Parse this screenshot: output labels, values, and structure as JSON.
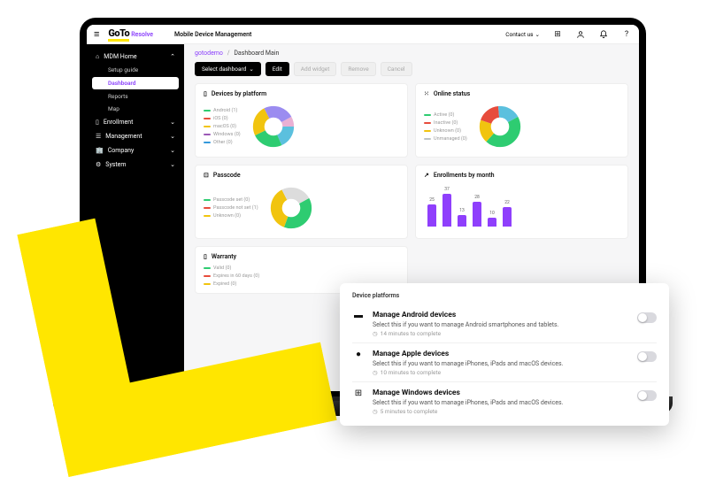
{
  "topbar": {
    "brand_main": "GoTo",
    "brand_sub": "Resolve",
    "page_title": "Mobile Device Management",
    "contact": "Contact us"
  },
  "sidebar": {
    "items": [
      {
        "icon": "home",
        "label": "MDM Home",
        "open": true,
        "children": [
          {
            "label": "Setup guide"
          },
          {
            "label": "Dashboard",
            "active": true
          },
          {
            "label": "Reports"
          },
          {
            "label": "Map"
          }
        ]
      },
      {
        "icon": "phone",
        "label": "Enrollment"
      },
      {
        "icon": "sliders",
        "label": "Management"
      },
      {
        "icon": "building",
        "label": "Company"
      },
      {
        "icon": "gear",
        "label": "System"
      }
    ]
  },
  "breadcrumbs": {
    "root": "gotodemo",
    "current": "Dashboard Main"
  },
  "toolbar": {
    "select_dashboard": "Select dashboard",
    "edit": "Edit",
    "add_widget": "Add widget",
    "remove": "Remove",
    "cancel": "Cancel"
  },
  "cards": {
    "devices_by_platform": {
      "title": "Devices by platform",
      "legend": [
        {
          "label": "Android (1)",
          "color": "#2ecc71"
        },
        {
          "label": "iOS (0)",
          "color": "#e74c3c"
        },
        {
          "label": "macOS (0)",
          "color": "#f1c40f"
        },
        {
          "label": "Windows (0)",
          "color": "#9b59b6"
        },
        {
          "label": "Other (0)",
          "color": "#3498db"
        }
      ]
    },
    "online_status": {
      "title": "Online status",
      "legend": [
        {
          "label": "Active (0)",
          "color": "#2ecc71"
        },
        {
          "label": "Inactive (0)",
          "color": "#e74c3c"
        },
        {
          "label": "Unknown (0)",
          "color": "#f1c40f"
        },
        {
          "label": "Unmanaged (0)",
          "color": "#bdc3c7"
        }
      ]
    },
    "passcode": {
      "title": "Passcode",
      "legend": [
        {
          "label": "Passcode set (0)",
          "color": "#2ecc71"
        },
        {
          "label": "Passcode not set (1)",
          "color": "#e74c3c"
        },
        {
          "label": "Unknown (0)",
          "color": "#f1c40f"
        }
      ]
    },
    "enrollments": {
      "title": "Enrollments by month"
    },
    "warranty": {
      "title": "Warranty",
      "legend": [
        {
          "label": "Valid (0)",
          "color": "#2ecc71"
        },
        {
          "label": "Expires in 60 days (0)",
          "color": "#e74c3c"
        },
        {
          "label": "Expired (0)",
          "color": "#f1c40f"
        }
      ]
    }
  },
  "chart_data": [
    {
      "type": "pie",
      "title": "Devices by platform",
      "series": [
        {
          "name": "Android",
          "value": 1,
          "color": "#2ecc71"
        },
        {
          "name": "iOS",
          "value": 0,
          "color": "#e74c3c"
        },
        {
          "name": "macOS",
          "value": 0,
          "color": "#f1c40f"
        },
        {
          "name": "Windows",
          "value": 0,
          "color": "#9b59b6"
        },
        {
          "name": "Other",
          "value": 0,
          "color": "#3498db"
        }
      ]
    },
    {
      "type": "pie",
      "title": "Online status",
      "series": [
        {
          "name": "Active",
          "value": 0,
          "color": "#2ecc71"
        },
        {
          "name": "Inactive",
          "value": 0,
          "color": "#e74c3c"
        },
        {
          "name": "Unknown",
          "value": 0,
          "color": "#f1c40f"
        },
        {
          "name": "Unmanaged",
          "value": 0,
          "color": "#bdc3c7"
        }
      ]
    },
    {
      "type": "pie",
      "title": "Passcode",
      "series": [
        {
          "name": "Passcode set",
          "value": 0,
          "color": "#2ecc71"
        },
        {
          "name": "Passcode not set",
          "value": 1,
          "color": "#e74c3c"
        },
        {
          "name": "Unknown",
          "value": 0,
          "color": "#f1c40f"
        }
      ]
    },
    {
      "type": "bar",
      "title": "Enrollments by month",
      "categories": [
        "",
        "",
        "",
        "",
        "",
        ""
      ],
      "values": [
        25,
        37,
        13,
        28,
        10,
        22
      ],
      "ylim": [
        0,
        40
      ]
    }
  ],
  "popup": {
    "heading": "Device platforms",
    "rows": [
      {
        "icon": "android",
        "title": "Manage Android devices",
        "desc": "Select this if you want to manage Android smartphones and tablets.",
        "time": "14 minutes to complete"
      },
      {
        "icon": "apple",
        "title": "Manage Apple devices",
        "desc": "Select this if you want to manage iPhones, iPads and macOS devices.",
        "time": "10 minutes to complete"
      },
      {
        "icon": "windows",
        "title": "Manage Windows devices",
        "desc": "Select this if you want to manage iPhones, iPads and macOS devices.",
        "time": "5 minutes to complete"
      }
    ]
  }
}
